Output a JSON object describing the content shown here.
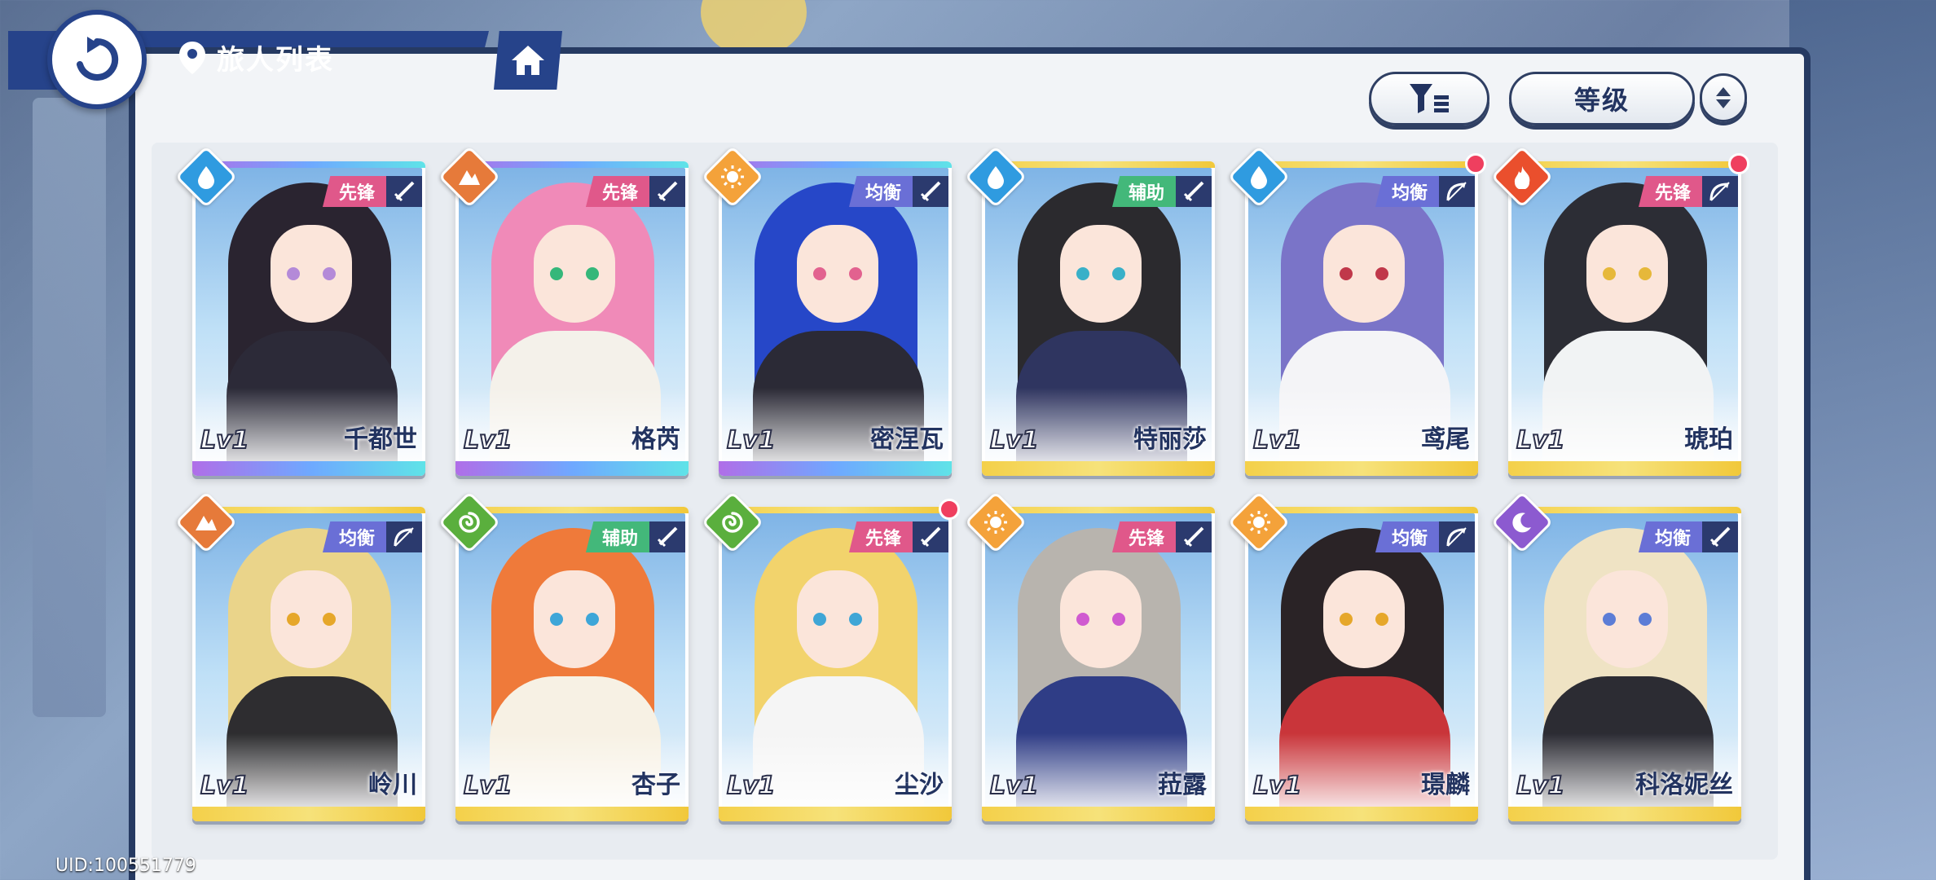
{
  "header": {
    "title": "旅人列表"
  },
  "toolbar": {
    "sort_label": "等级"
  },
  "uid": "UID:100551779",
  "colors": {
    "primary": "#26438a",
    "water": "#2f9be0",
    "earth": "#e67a3a",
    "light": "#f4a23a",
    "fire": "#ea4f2d",
    "wind": "#5aaf3d",
    "moon": "#8c5ad0",
    "vanguard": "#e0588a",
    "balance": "#6a6fd6",
    "support": "#43b87a"
  },
  "cards": [
    {
      "level": "Lv1",
      "name": "千都世",
      "role": "先锋",
      "element": "water-icon",
      "weapon": "sword-icon",
      "rarity": "purple",
      "hair": "#2a2430",
      "eyes": "#b48ad8",
      "outfit": "#2c2a38",
      "new": false
    },
    {
      "level": "Lv1",
      "name": "格芮",
      "role": "先锋",
      "element": "earth-icon",
      "weapon": "sword-icon",
      "rarity": "purple",
      "hair": "#f08ab8",
      "eyes": "#35b77a",
      "outfit": "#f4f1ea",
      "new": false
    },
    {
      "level": "Lv1",
      "name": "密涅瓦",
      "role": "均衡",
      "element": "light-icon",
      "weapon": "sword-icon",
      "rarity": "purple",
      "hair": "#2647c8",
      "eyes": "#e2628f",
      "outfit": "#2b2a36",
      "new": false
    },
    {
      "level": "Lv1",
      "name": "特丽莎",
      "role": "辅助",
      "element": "water-icon",
      "weapon": "sword-icon",
      "rarity": "gold",
      "hair": "#2b2a2e",
      "eyes": "#39b0c8",
      "outfit": "#2f3560",
      "new": false
    },
    {
      "level": "Lv1",
      "name": "鸢尾",
      "role": "均衡",
      "element": "water-icon",
      "weapon": "bow-icon",
      "rarity": "gold",
      "hair": "#7a74c8",
      "eyes": "#c0384a",
      "outfit": "#f4f4f7",
      "new": true
    },
    {
      "level": "Lv1",
      "name": "琥珀",
      "role": "先锋",
      "element": "fire-icon",
      "weapon": "bow-icon",
      "rarity": "gold",
      "hair": "#2c2d35",
      "eyes": "#e6b83a",
      "outfit": "#f1f3f4",
      "new": true
    },
    {
      "level": "Lv1",
      "name": "岭川",
      "role": "均衡",
      "element": "earth-icon",
      "weapon": "bow-icon",
      "rarity": "gold",
      "hair": "#ead48a",
      "eyes": "#e6a72a",
      "outfit": "#2e2d30",
      "new": false
    },
    {
      "level": "Lv1",
      "name": "杏子",
      "role": "辅助",
      "element": "wind-icon",
      "weapon": "sword-icon",
      "rarity": "gold",
      "hair": "#ef7a3a",
      "eyes": "#3ea6d8",
      "outfit": "#f7f1e4",
      "new": false
    },
    {
      "level": "Lv1",
      "name": "尘沙",
      "role": "先锋",
      "element": "wind-icon",
      "weapon": "sword-icon",
      "rarity": "gold",
      "hair": "#f2d36c",
      "eyes": "#3fa6d6",
      "outfit": "#f5f5f5",
      "new": true
    },
    {
      "level": "Lv1",
      "name": "菈露",
      "role": "先锋",
      "element": "light-icon",
      "weapon": "sword-icon",
      "rarity": "gold",
      "hair": "#b8b4ae",
      "eyes": "#d05ad0",
      "outfit": "#2f3d86",
      "new": false
    },
    {
      "level": "Lv1",
      "name": "璟麟",
      "role": "均衡",
      "element": "light-icon",
      "weapon": "bow-icon",
      "rarity": "gold",
      "hair": "#2a2326",
      "eyes": "#e6a72a",
      "outfit": "#c9353a",
      "new": false
    },
    {
      "level": "Lv1",
      "name": "科洛妮丝",
      "role": "均衡",
      "element": "moon-icon",
      "weapon": "sword-icon",
      "rarity": "gold",
      "hair": "#efe3c4",
      "eyes": "#5c7dd6",
      "outfit": "#2c2c33",
      "new": false
    }
  ]
}
